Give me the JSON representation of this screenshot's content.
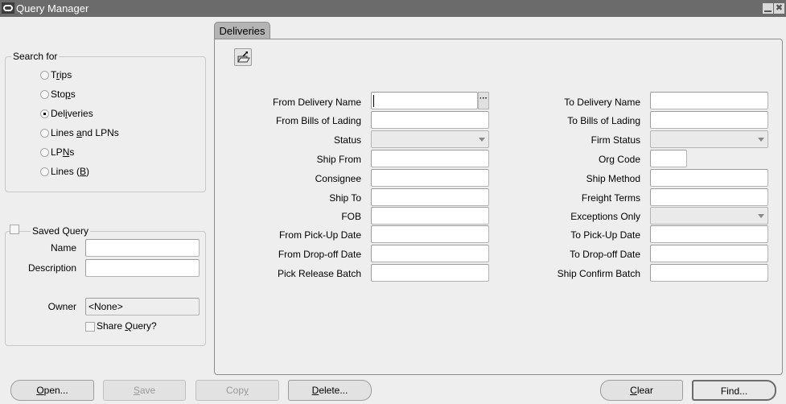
{
  "window": {
    "title": "Query Manager",
    "minimize_icon": "minimize-icon",
    "close_icon": "close-icon",
    "close_glyph": "✖"
  },
  "search_for": {
    "legend": "Search for",
    "options": [
      {
        "pre": "T",
        "mn": "r",
        "post": "ips",
        "checked": false
      },
      {
        "pre": "Sto",
        "mn": "p",
        "post": "s",
        "checked": false
      },
      {
        "pre": "Del",
        "mn": "i",
        "post": "veries",
        "checked": true
      },
      {
        "pre": "Lines ",
        "mn": "a",
        "post": "nd LPNs",
        "checked": false
      },
      {
        "pre": "LP",
        "mn": "N",
        "post": "s",
        "checked": false
      },
      {
        "pre": "Lines (",
        "mn": "B",
        "post": ")",
        "checked": false
      }
    ]
  },
  "saved_query": {
    "legend": "Saved Query",
    "checked": false,
    "name_label": "Name",
    "name_value": "",
    "description_label": "Description",
    "description_value": "",
    "owner_label": "Owner",
    "owner_value": "<None>",
    "share_pre": "Share ",
    "share_mn": "Q",
    "share_post": "uery?",
    "share_checked": false
  },
  "tab": {
    "label": "Deliveries",
    "toolbar_icon": "open-folder-icon",
    "lov_glyph": "···"
  },
  "fields_left": [
    {
      "label": "From Delivery Name",
      "type": "text",
      "value": ""
    },
    {
      "label": "From Bills of Lading",
      "type": "text",
      "value": ""
    },
    {
      "label": "Status",
      "type": "select",
      "value": ""
    },
    {
      "label": "Ship From",
      "type": "text",
      "value": ""
    },
    {
      "label": "Consignee",
      "type": "text",
      "value": ""
    },
    {
      "label": "Ship To",
      "type": "text",
      "value": ""
    },
    {
      "label": "FOB",
      "type": "text",
      "value": ""
    },
    {
      "label": "From Pick-Up Date",
      "type": "text",
      "value": ""
    },
    {
      "label": "From Drop-off Date",
      "type": "text",
      "value": ""
    },
    {
      "label": "Pick Release Batch",
      "type": "text",
      "value": ""
    }
  ],
  "fields_right": [
    {
      "label": "To Delivery Name",
      "type": "text",
      "value": ""
    },
    {
      "label": "To Bills of Lading",
      "type": "text",
      "value": ""
    },
    {
      "label": "Firm Status",
      "type": "select",
      "value": ""
    },
    {
      "label": "Org Code",
      "type": "text",
      "value": ""
    },
    {
      "label": "Ship Method",
      "type": "text",
      "value": ""
    },
    {
      "label": "Freight Terms",
      "type": "text",
      "value": ""
    },
    {
      "label": "Exceptions Only",
      "type": "select",
      "value": ""
    },
    {
      "label": "To Pick-Up Date",
      "type": "text",
      "value": ""
    },
    {
      "label": "To Drop-off Date",
      "type": "text",
      "value": ""
    },
    {
      "label": "Ship Confirm Batch",
      "type": "text",
      "value": ""
    }
  ],
  "buttons": {
    "open": {
      "mn": "O",
      "post": "pen..."
    },
    "save": {
      "mn": "S",
      "post": "ave"
    },
    "copy": {
      "pre": "Cop",
      "mn": "y"
    },
    "delete": {
      "mn": "D",
      "post": "elete..."
    },
    "clear": {
      "mn": "C",
      "post": "lear"
    },
    "find": {
      "label": "Find..."
    }
  }
}
